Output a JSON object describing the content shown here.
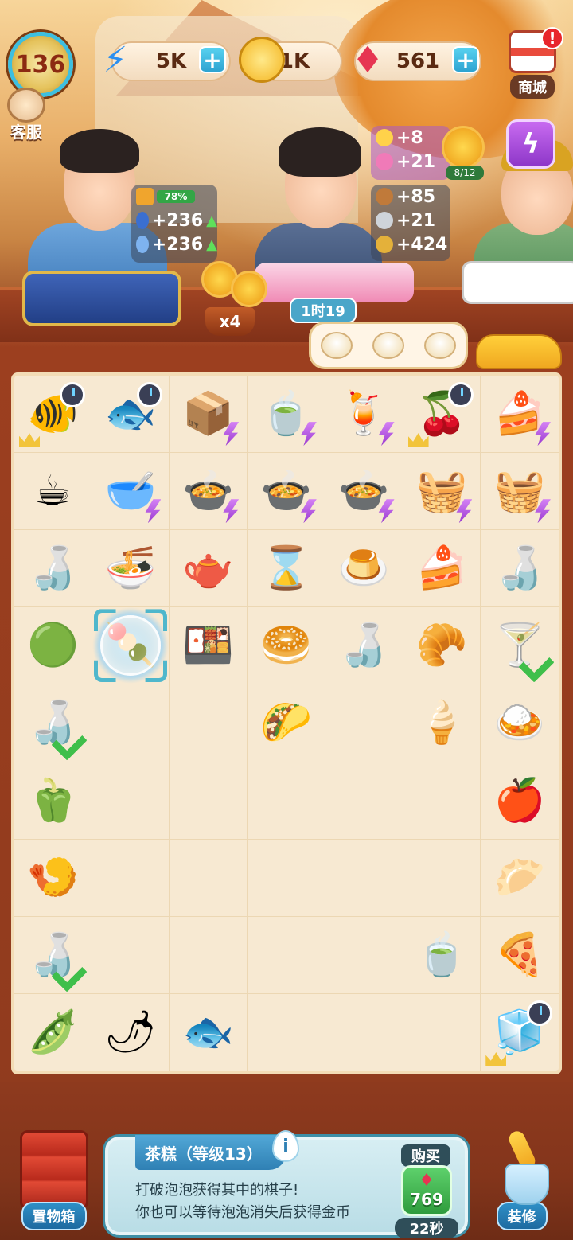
{
  "top": {
    "level": "136",
    "energy": "5K",
    "coins": "1K",
    "gems": "561",
    "shop_label": "商城",
    "shop_alert": "!",
    "service_label": "客服"
  },
  "bonus_left": {
    "progress": "78%",
    "stat1": "+236",
    "stat2": "+236"
  },
  "bonus_right_top": {
    "stat1": "+8",
    "stat2": "+21",
    "sunflower_progress": "8/12"
  },
  "bonus_right": {
    "stat1": "+85",
    "stat2": "+21",
    "stat3": "+424"
  },
  "counter": {
    "pot_count": "x4",
    "timer": "1时19"
  },
  "board": {
    "cells": [
      [
        "🐠",
        "🐟",
        "📦",
        "🍵",
        "🍹",
        "🍒",
        "🍰"
      ],
      [
        "☕",
        "🥣",
        "🍲",
        "🍲",
        "🍲",
        "🧺",
        "🧺"
      ],
      [
        "🍶",
        "🍜",
        "🫖",
        "⌛",
        "🍮",
        "🍰",
        "🍶"
      ],
      [
        "🟢",
        "🍡",
        "🍱",
        "🥯",
        "🍶",
        "🥐",
        "🍸"
      ],
      [
        "🍶",
        "",
        "",
        "🌮",
        "",
        "🍦",
        "🍛"
      ],
      [
        "🫑",
        "",
        "",
        "",
        "",
        "",
        "🍎"
      ],
      [
        "🍤",
        "",
        "",
        "",
        "",
        "",
        "🥟"
      ],
      [
        "🍶",
        "",
        "",
        "",
        "",
        "🍵",
        "🍕"
      ],
      [
        "🫛",
        "🌶",
        "🐟",
        "",
        "",
        "",
        "🧊"
      ]
    ]
  },
  "bottom": {
    "storage_label": "置物箱",
    "decor_label": "装修",
    "item_title": "茶糕（等级13）",
    "info_icon": "i",
    "info_line1": "打破泡泡获得其中的棋子!",
    "info_line2": "你也可以等待泡泡消失后获得金币",
    "buy_label": "购买",
    "buy_price": "769",
    "buy_timer": "22秒"
  },
  "colors": {
    "accent": "#4fb7cc",
    "board_bg": "#f7e9d2",
    "frame": "#8e3a1e"
  }
}
